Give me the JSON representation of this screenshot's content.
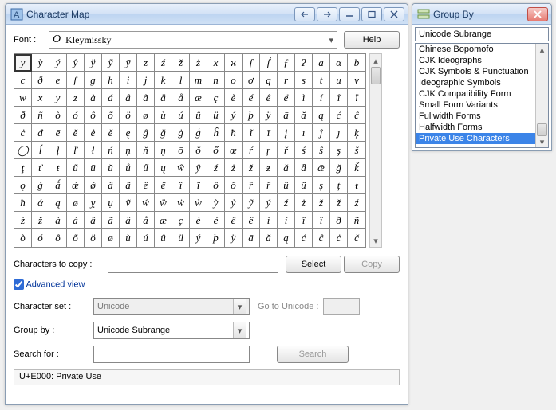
{
  "main_window": {
    "title": "Character Map",
    "font_label": "Font :",
    "font_name": "Kleymissky",
    "help_button": "Help",
    "copy_label": "Characters to copy :",
    "copy_value": "",
    "select_button": "Select",
    "copy_button": "Copy",
    "advanced_label": "Advanced view",
    "advanced_checked": true,
    "charset_label": "Character set :",
    "charset_value": "Unicode",
    "goto_label": "Go to Unicode :",
    "goto_value": "",
    "groupby_label": "Group by :",
    "groupby_value": "Unicode Subrange",
    "search_label": "Search for :",
    "search_value": "",
    "search_button": "Search",
    "status": "U+E000: Private Use"
  },
  "grid": {
    "cols": 20,
    "selected": [
      0,
      0
    ],
    "rows": [
      [
        "y",
        "ỳ",
        "ý",
        "ŷ",
        "ÿ",
        "ỹ",
        "ȳ",
        "z",
        "ź",
        "ž",
        "ż",
        "x",
        "ϰ",
        "ſ",
        "ẛ",
        "ƒ",
        "ʔ",
        "a",
        "α",
        "b"
      ],
      [
        "c",
        "ð",
        "e",
        "ƒ",
        "ɡ",
        "h",
        "i",
        "j",
        "k",
        "l",
        "m",
        "n",
        "o",
        "ơ",
        "q",
        "r",
        "s",
        "t",
        "u",
        "v"
      ],
      [
        "w",
        "x",
        "y",
        "z",
        "à",
        "á",
        "â",
        "ã",
        "ä",
        "å",
        "æ",
        "ç",
        "è",
        "é",
        "ê",
        "ë",
        "ì",
        "í",
        "î",
        "ï"
      ],
      [
        "ð",
        "ñ",
        "ò",
        "ó",
        "ô",
        "õ",
        "ö",
        "ø",
        "ù",
        "ú",
        "û",
        "ü",
        "ý",
        "þ",
        "ÿ",
        "ā",
        "ă",
        "ą",
        "ć",
        "ĉ"
      ],
      [
        "ċ",
        "đ",
        "ē",
        "ĕ",
        "ė",
        "ě",
        "ę",
        "ĝ",
        "ğ",
        "ġ",
        "ģ",
        "ĥ",
        "ħ",
        "ĩ",
        "ī",
        "į",
        "ı",
        "ĵ",
        "ȷ",
        "ķ"
      ],
      [
        "◯",
        "ĺ",
        "ļ",
        "ľ",
        "ł",
        "ń",
        "ņ",
        "ň",
        "ŋ",
        "ō",
        "ŏ",
        "ő",
        "œ",
        "ŕ",
        "ŗ",
        "ř",
        "ś",
        "ŝ",
        "ş",
        "š"
      ],
      [
        "ţ",
        "ť",
        "ŧ",
        "ũ",
        "ū",
        "ŭ",
        "ů",
        "ű",
        "ų",
        "ŵ",
        "ŷ",
        "ź",
        "ż",
        "ž",
        "ƶ",
        "ǎ",
        "ǟ",
        "ǣ",
        "ǧ",
        "ǩ"
      ],
      [
        "ǫ",
        "ǵ",
        "ǻ",
        "ǽ",
        "ǿ",
        "ȁ",
        "ȃ",
        "ȅ",
        "ȇ",
        "ȉ",
        "ȋ",
        "ȍ",
        "ȏ",
        "ȑ",
        "ȓ",
        "ȕ",
        "ȗ",
        "ș",
        "ț",
        "ŧ"
      ],
      [
        "ћ",
        "ά",
        "ą",
        "ø",
        "ỵ",
        "ụ",
        "ṽ",
        "ẃ",
        "ẅ",
        "ẇ",
        "ẁ",
        "ỳ",
        "ỷ",
        "ỹ",
        "ý",
        "ź",
        "ż",
        "ž",
        "ž",
        "ź"
      ],
      [
        "ż",
        "ž",
        "à",
        "á",
        "â",
        "ã",
        "ä",
        "å",
        "æ",
        "ç",
        "è",
        "é",
        "ê",
        "ë",
        "ì",
        "í",
        "î",
        "ï",
        "ð",
        "ñ"
      ],
      [
        "ò",
        "ó",
        "ô",
        "õ",
        "ö",
        "ø",
        "ù",
        "ú",
        "û",
        "ü",
        "ý",
        "þ",
        "ÿ",
        "ā",
        "ă",
        "ą",
        "ć",
        "ĉ",
        "ċ",
        "č"
      ]
    ]
  },
  "group_window": {
    "title": "Group By",
    "header": "Unicode Subrange",
    "items": [
      "Chinese Bopomofo",
      "CJK Ideographs",
      "CJK Symbols & Punctuation",
      "Ideographic Symbols",
      "CJK Compatibility Form",
      "Small Form Variants",
      "Fullwidth Forms",
      "Halfwidth Forms",
      "Private Use Characters"
    ],
    "selected_index": 8
  }
}
